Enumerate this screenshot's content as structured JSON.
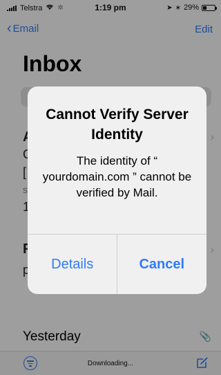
{
  "status_bar": {
    "carrier": "Telstra",
    "time": "1:19 pm",
    "battery": "29%",
    "battery_level": 0.29
  },
  "nav": {
    "back_label": "Email",
    "edit_label": "Edit"
  },
  "page": {
    "title": "Inbox"
  },
  "list_fragments": {
    "row1": "A",
    "row1b": "G",
    "row1c": "[",
    "row1d": "s",
    "row1e": "1",
    "row2": "F",
    "row2b": "p"
  },
  "section": {
    "yesterday": "Yesterday"
  },
  "toolbar": {
    "status": "Downloading..."
  },
  "alert": {
    "title": "Cannot Verify Server Identity",
    "message": "The identity of “ yourdomain.com ” cannot be verified by Mail.",
    "details_button": "Details",
    "cancel_button": "Cancel"
  },
  "colors": {
    "accent": "#2f7cf6",
    "alert_background": "#f0f0f0",
    "overlay": "rgba(0,0,0,0.38)"
  },
  "icons": {
    "back": "chevron-left-icon",
    "filter": "filter-icon",
    "compose": "compose-icon",
    "wifi": "wifi-icon",
    "battery": "battery-icon",
    "paperclip": "paperclip-icon"
  }
}
